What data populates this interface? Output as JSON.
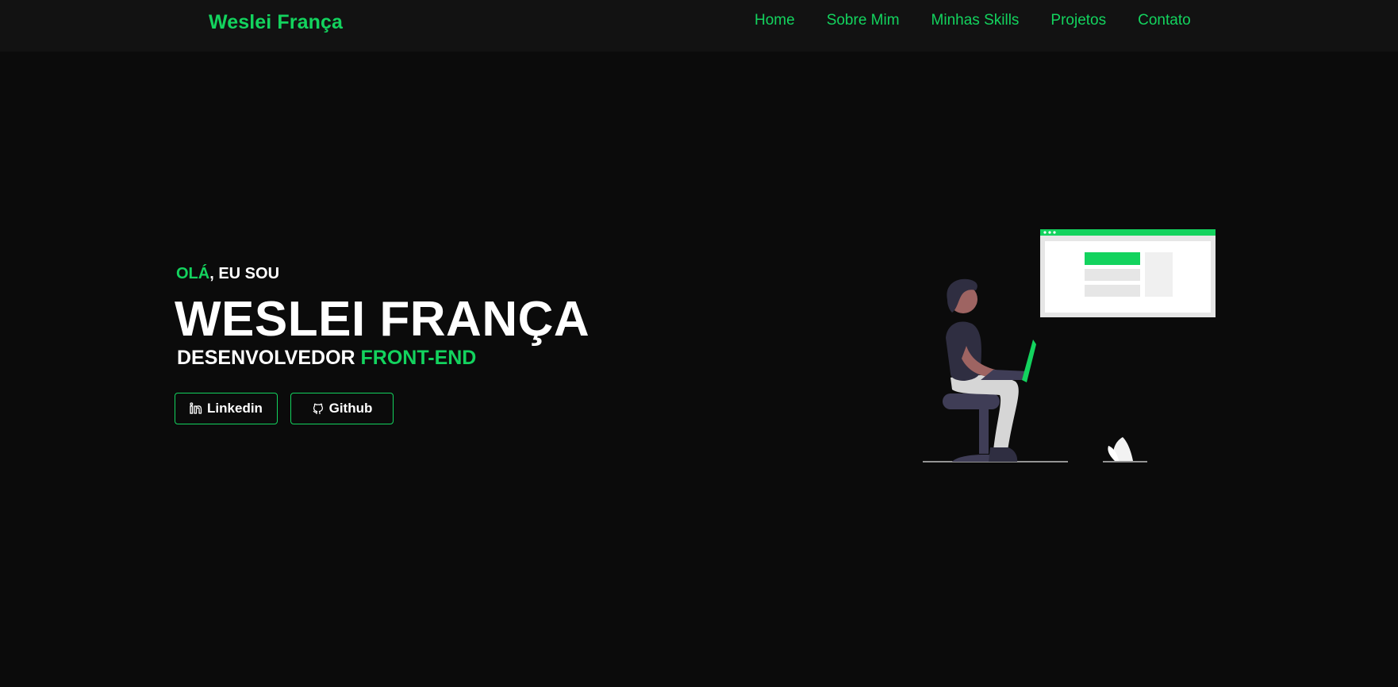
{
  "navbar": {
    "brand": "Weslei França",
    "links": [
      {
        "label": "Home"
      },
      {
        "label": "Sobre Mim"
      },
      {
        "label": "Minhas Skills"
      },
      {
        "label": "Projetos"
      },
      {
        "label": "Contato"
      }
    ]
  },
  "hero": {
    "greeting_accent": "OLÁ",
    "greeting_rest": ", EU SOU",
    "name": "WESLEI FRANÇA",
    "role_prefix": "DESENVOLVEDOR",
    "role_accent": "FRONT-END",
    "buttons": {
      "linkedin": {
        "label": "Linkedin",
        "icon": "linkedin-icon"
      },
      "github": {
        "label": "Github",
        "icon": "github-icon"
      }
    }
  },
  "colors": {
    "accent": "#13d35e",
    "background": "#0b0b0b",
    "navbar": "#121212",
    "text": "#ffffff"
  }
}
